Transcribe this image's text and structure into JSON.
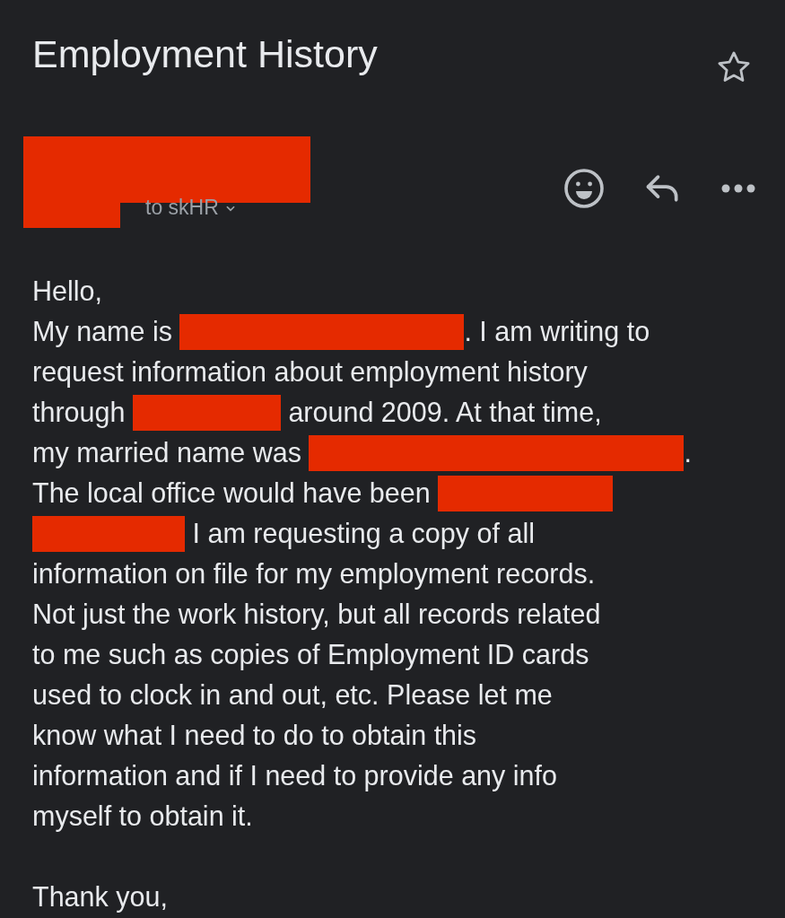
{
  "subject": "Employment History",
  "starred": false,
  "recipient": "to skHR",
  "body": [
    [
      {
        "kind": "text",
        "text": "Hello,"
      }
    ],
    [
      {
        "kind": "text",
        "text": "My name is "
      },
      {
        "kind": "redaction"
      },
      {
        "kind": "text",
        "text": ". I am writing to"
      }
    ],
    [
      {
        "kind": "text",
        "text": "request information about employment history"
      }
    ],
    [
      {
        "kind": "text",
        "text": "through "
      },
      {
        "kind": "redaction"
      },
      {
        "kind": "text",
        "text": " around 2009. At that time,"
      }
    ],
    [
      {
        "kind": "text",
        "text": "my married name was "
      },
      {
        "kind": "redaction"
      },
      {
        "kind": "text",
        "text": "."
      }
    ],
    [
      {
        "kind": "text",
        "text": "The local office would have been "
      },
      {
        "kind": "redaction"
      }
    ],
    [
      {
        "kind": "redaction"
      },
      {
        "kind": "text",
        "text": " I am requesting a copy of all"
      }
    ],
    [
      {
        "kind": "text",
        "text": "information on file for my employment records."
      }
    ],
    [
      {
        "kind": "text",
        "text": "Not just the work history, but all records related"
      }
    ],
    [
      {
        "kind": "text",
        "text": "to me such as copies of Employment ID cards"
      }
    ],
    [
      {
        "kind": "text",
        "text": "used to clock in and out, etc. Please let me"
      }
    ],
    [
      {
        "kind": "text",
        "text": "know what I need to do to obtain this"
      }
    ],
    [
      {
        "kind": "text",
        "text": "information and if I need to provide any info"
      }
    ],
    [
      {
        "kind": "text",
        "text": "myself to obtain it."
      }
    ]
  ],
  "closing": "Thank you,"
}
